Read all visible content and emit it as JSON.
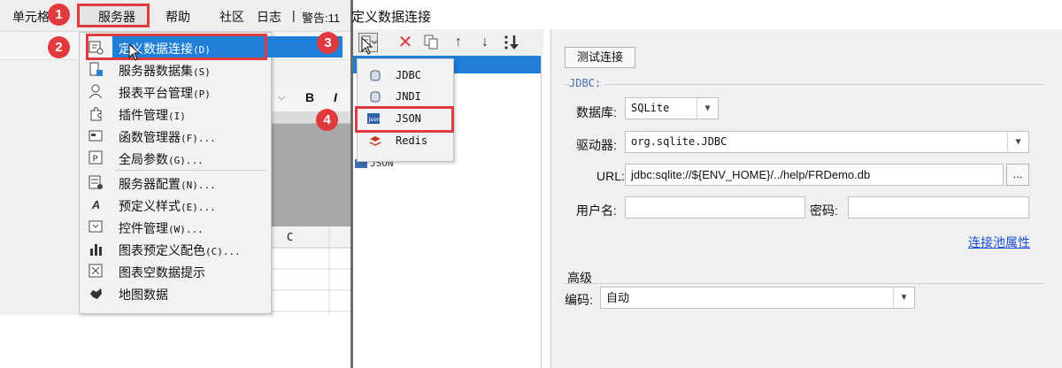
{
  "menubar": {
    "cell_label": "单元格",
    "server_label": "服务器",
    "help_label": "帮助",
    "community_label": "社区",
    "log_label": "日志",
    "separator": "|",
    "warning_label": "警告:11"
  },
  "server_menu": {
    "items": [
      {
        "label": "定义数据连接",
        "shortcut": "(D)",
        "icon": "database-connection-icon"
      },
      {
        "label": "服务器数据集",
        "shortcut": "(S)",
        "icon": "server-dataset-icon"
      },
      {
        "label": "报表平台管理",
        "shortcut": "(P)",
        "icon": "user-icon"
      },
      {
        "label": "插件管理",
        "shortcut": "(I)",
        "icon": "plugin-icon"
      },
      {
        "label": "函数管理器",
        "shortcut": "(F)...",
        "icon": "function-manager-icon"
      },
      {
        "label": "全局参数",
        "shortcut": "(G)...",
        "icon": "global-parameter-icon"
      },
      {
        "label": "服务器配置",
        "shortcut": "(N)...",
        "icon": "server-config-icon"
      },
      {
        "label": "预定义样式",
        "shortcut": "(E)...",
        "icon": "predefined-style-icon"
      },
      {
        "label": "控件管理",
        "shortcut": "(W)...",
        "icon": "widget-manager-icon"
      },
      {
        "label": "图表预定义配色",
        "shortcut": "(C)...",
        "icon": "chart-color-icon"
      },
      {
        "label": "图表空数据提示",
        "shortcut": "",
        "icon": "empty-data-icon"
      },
      {
        "label": "地图数据",
        "shortcut": "",
        "icon": "map-data-icon"
      }
    ]
  },
  "sheet": {
    "column_c": "C",
    "bold_label": "B",
    "italic_label": "I"
  },
  "badges": [
    "1",
    "2",
    "3",
    "4"
  ],
  "dialog": {
    "title": "定义数据连接",
    "types": [
      {
        "label": "JDBC",
        "icon": "jdbc-icon"
      },
      {
        "label": "JNDI",
        "icon": "jndi-icon"
      },
      {
        "label": "JSON",
        "icon": "json-icon"
      },
      {
        "label": "Redis",
        "icon": "redis-icon"
      }
    ],
    "list_peek": "JSON"
  },
  "config": {
    "test_button": "测试连接",
    "group_jdbc": "JDBC:",
    "database_label": "数据库:",
    "database_value": "SQLite",
    "driver_label": "驱动器:",
    "driver_value": "org.sqlite.JDBC",
    "url_label": "URL:",
    "url_value": "jdbc:sqlite://${ENV_HOME}/../help/FRDemo.db",
    "ellipsis": "...",
    "username_label": "用户名:",
    "username_value": "",
    "password_label": "密码:",
    "password_value": "",
    "pool_link": "连接池属性",
    "advanced_label": "高级",
    "encoding_label": "编码:",
    "encoding_value": "自动"
  },
  "colors": {
    "accent_red": "#e0393e",
    "selection_blue": "#1e7ed8",
    "link_blue": "#1a4fd0"
  }
}
